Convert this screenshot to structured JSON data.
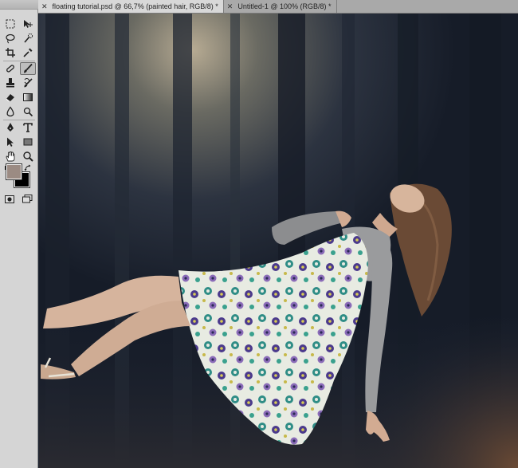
{
  "tabs": [
    {
      "label": "floating tutorial.psd @ 66,7% (painted hair, RGB/8) *",
      "active": true
    },
    {
      "label": "Untitled-1 @ 100% (RGB/8) *",
      "active": false
    }
  ],
  "tools": [
    {
      "name": "marquee-tool-icon",
      "active": false
    },
    {
      "name": "move-tool-icon",
      "active": false
    },
    {
      "name": "lasso-tool-icon",
      "active": false
    },
    {
      "name": "quick-selection-tool-icon",
      "active": false
    },
    {
      "name": "crop-tool-icon",
      "active": false
    },
    {
      "name": "eyedropper-tool-icon",
      "active": false
    },
    {
      "name": "healing-brush-tool-icon",
      "active": false
    },
    {
      "name": "brush-tool-icon",
      "active": true
    },
    {
      "name": "clone-stamp-tool-icon",
      "active": false
    },
    {
      "name": "history-brush-tool-icon",
      "active": false
    },
    {
      "name": "eraser-tool-icon",
      "active": false
    },
    {
      "name": "gradient-tool-icon",
      "active": false
    },
    {
      "name": "blur-tool-icon",
      "active": false
    },
    {
      "name": "dodge-tool-icon",
      "active": false
    },
    {
      "name": "pen-tool-icon",
      "active": false
    },
    {
      "name": "type-tool-icon",
      "active": false
    },
    {
      "name": "path-selection-tool-icon",
      "active": false
    },
    {
      "name": "rectangle-tool-icon",
      "active": false
    },
    {
      "name": "hand-tool-icon",
      "active": false
    },
    {
      "name": "zoom-tool-icon",
      "active": false
    }
  ],
  "colors": {
    "foreground": "#9b8b83",
    "background": "#000000"
  }
}
